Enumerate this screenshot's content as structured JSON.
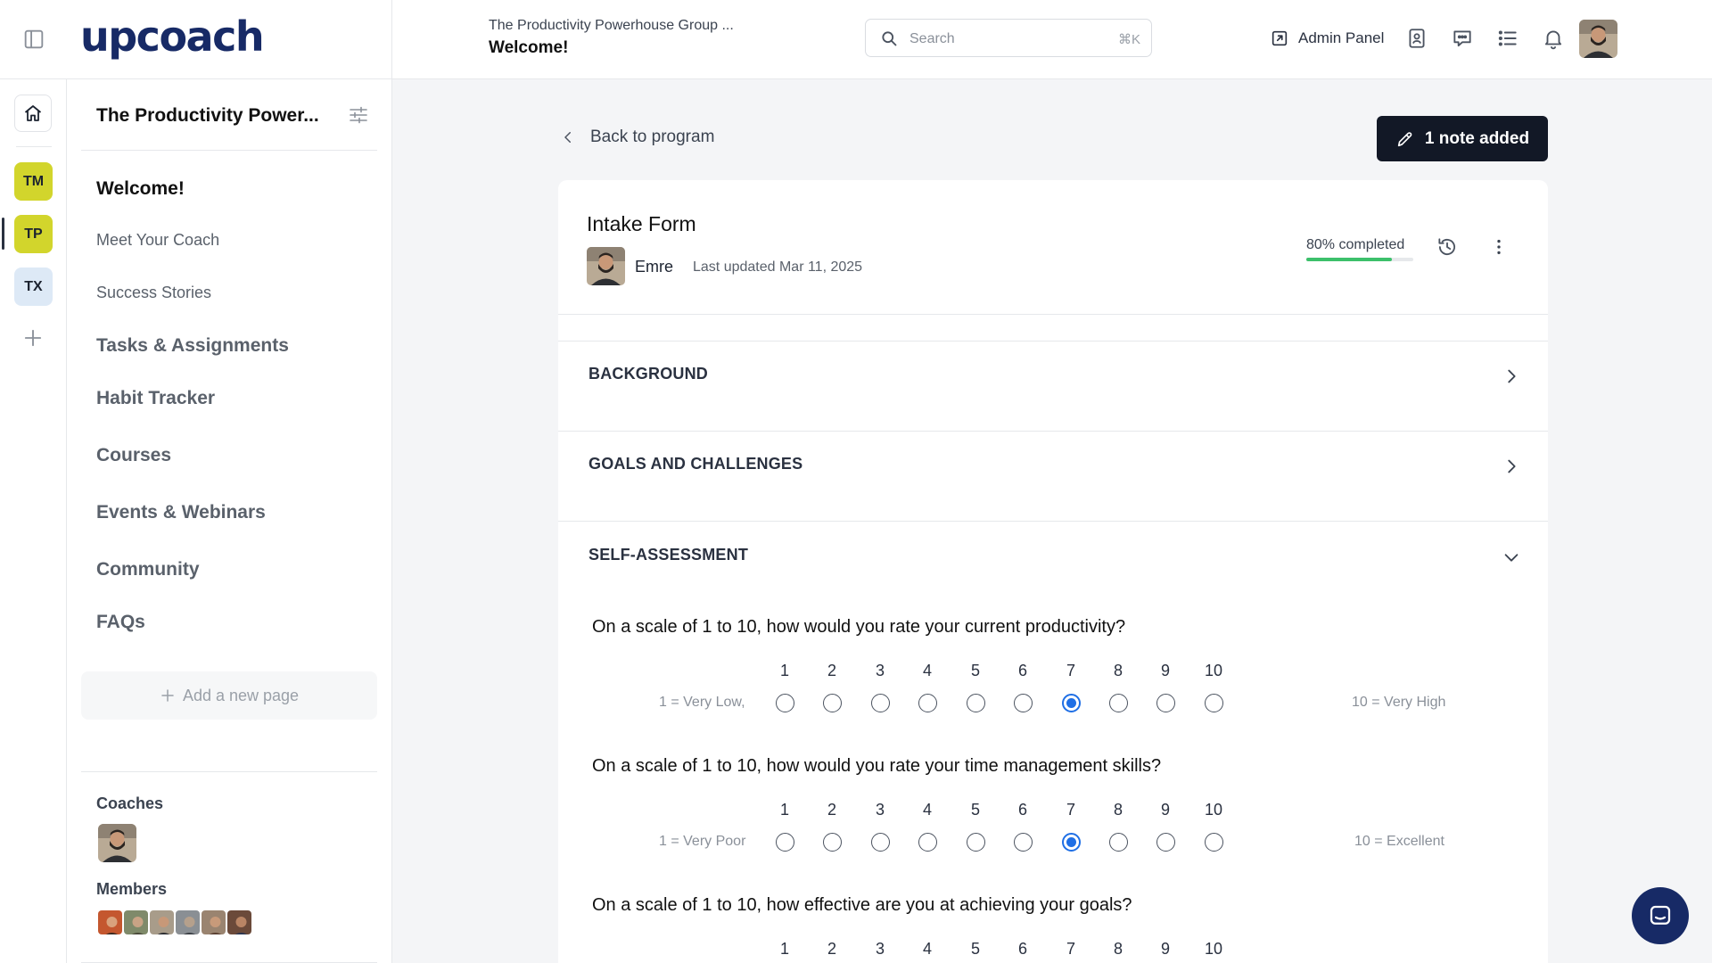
{
  "app": {
    "logo": "upcoach"
  },
  "header": {
    "group": "The Productivity Powerhouse Group ...",
    "page": "Welcome!",
    "search": {
      "placeholder": "Search",
      "shortcut": "⌘K"
    },
    "admin_label": "Admin Panel"
  },
  "rail": {
    "workspaces": [
      "TM",
      "TP",
      "TX"
    ]
  },
  "sidebar": {
    "title": "The Productivity Power...",
    "items": [
      {
        "label": "Welcome!"
      },
      {
        "label": "Meet Your Coach"
      },
      {
        "label": "Success Stories"
      },
      {
        "label": "Tasks & Assignments"
      },
      {
        "label": "Habit Tracker"
      },
      {
        "label": "Courses"
      },
      {
        "label": "Events & Webinars"
      },
      {
        "label": "Community"
      },
      {
        "label": "FAQs"
      }
    ],
    "add_page": "Add a new page",
    "coaches_label": "Coaches",
    "members_label": "Members"
  },
  "main": {
    "back_label": "Back to program",
    "note_button": "1 note added",
    "form": {
      "title": "Intake Form",
      "author": "Emre",
      "updated": "Last updated Mar 11, 2025",
      "progress_label": "80% completed",
      "progress": 0.8
    },
    "sections": [
      "BACKGROUND",
      "GOALS AND CHALLENGES",
      "SELF-ASSESSMENT"
    ],
    "questions": [
      {
        "text": "On a scale of 1 to 10, how would you rate your current productivity?",
        "low": "1 = Very Low,",
        "high": "10 = Very High",
        "selected": 7
      },
      {
        "text": "On a scale of 1 to 10, how would you rate your time management skills?",
        "low": "1 = Very Poor",
        "high": "10 = Excellent",
        "selected": 7
      },
      {
        "text": "On a scale of 1 to 10, how effective are you at achieving your goals?",
        "low": "",
        "high": "",
        "selected": null
      }
    ],
    "scale_numbers": [
      "1",
      "2",
      "3",
      "4",
      "5",
      "6",
      "7",
      "8",
      "9",
      "10"
    ]
  },
  "colors": {
    "brand": "#172a66",
    "workspace_yellow": "#d2d52c",
    "workspace_blue": "#dde9f6",
    "progress": "#3cc06b",
    "radio_selected": "#1f6fe5",
    "button_dark": "#121826"
  },
  "icons": {
    "collapse": "sidebar-toggle-icon",
    "search": "search-icon",
    "admin": "external-link-icon",
    "tb1": "contact-card-icon",
    "tb2": "chat-icon",
    "tb3": "list-icon",
    "tb4": "bell-icon",
    "home": "home-icon",
    "add": "plus-icon",
    "settings": "sliders-icon",
    "note": "pencil-icon",
    "history": "history-icon",
    "more": "more-vertical-icon",
    "chat_fab": "messenger-icon"
  }
}
